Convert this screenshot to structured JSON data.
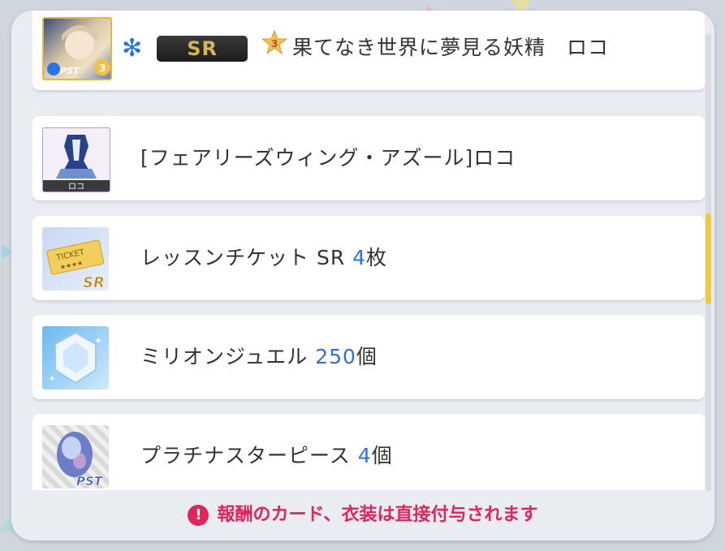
{
  "colors": {
    "accent_blue": "#2f6fe0",
    "notice_red": "#e2245c",
    "scroll_thumb": "#f1c940"
  },
  "rewards": [
    {
      "type": "card",
      "attribute_icon": "snowflake-icon",
      "rarity": "SR",
      "star_icon": "star-3-icon",
      "star_text": "3",
      "title": "果てなき世界に夢見る妖精　ロコ"
    },
    {
      "type": "costume",
      "label": "[フェアリーズウィング・アズール]ロコ",
      "thumb_caption": "ロコ"
    },
    {
      "type": "ticket",
      "label": "レッスンチケット SR ",
      "count": "4",
      "unit": "枚",
      "thumb_text": "TICKET",
      "thumb_badge": "SR"
    },
    {
      "type": "jewel",
      "label": "ミリオンジュエル ",
      "count": "250",
      "unit": "個"
    },
    {
      "type": "piece",
      "label": "プラチナスターピース ",
      "count": "4",
      "unit": "個",
      "thumb_badge": "PST"
    }
  ],
  "card_badge": "PST",
  "notice": {
    "icon": "exclamation-icon",
    "icon_text": "!",
    "text": "報酬のカード、衣装は直接付与されます"
  }
}
